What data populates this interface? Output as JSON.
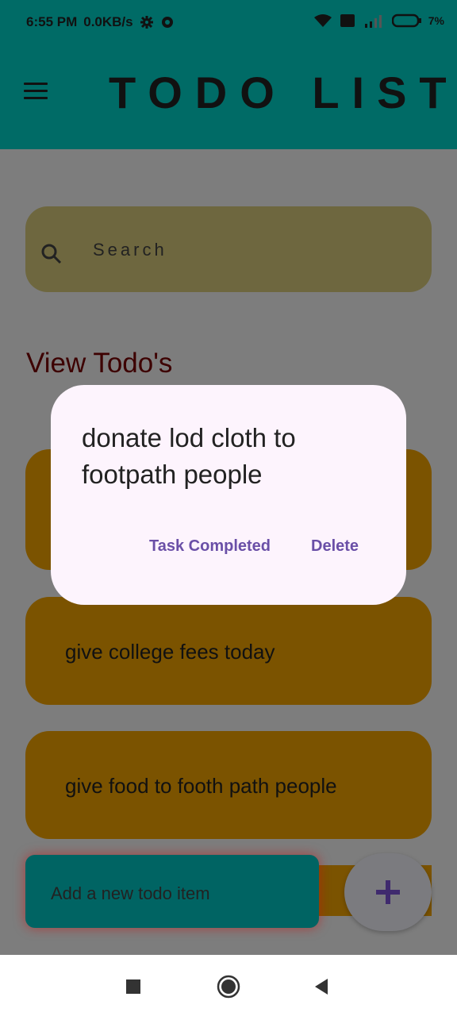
{
  "status_bar": {
    "time": "6:55 PM",
    "speed": "0.0KB/s",
    "battery": "7%"
  },
  "app_bar": {
    "title": "TODO LIST"
  },
  "search": {
    "placeholder": "Search"
  },
  "section_title": "View Todo's",
  "todos": [
    {
      "text": ""
    },
    {
      "text": "give college fees today"
    },
    {
      "text": "give food to footh path people"
    }
  ],
  "add_todo": {
    "placeholder": "Add a new todo item"
  },
  "fab": {
    "label": "+"
  },
  "dialog": {
    "title": "donate lod cloth to footpath people",
    "complete_label": "Task Completed",
    "delete_label": "Delete"
  },
  "colors": {
    "app_bar": "#006b66",
    "todo_card": "#f7a600",
    "dialog_bg": "#fdf4fd",
    "action": "#6a4fa7"
  }
}
